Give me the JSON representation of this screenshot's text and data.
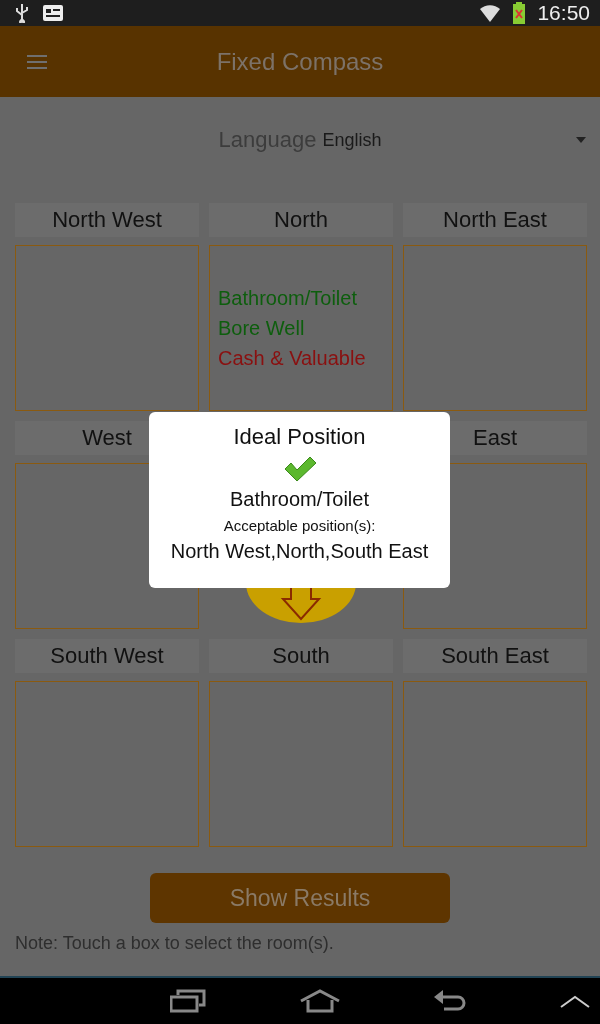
{
  "status_bar": {
    "time": "16:50"
  },
  "app_bar": {
    "title": "Fixed Compass"
  },
  "language": {
    "label": "Language",
    "value": "English"
  },
  "grid": [
    {
      "kind": "room",
      "label": "North West"
    },
    {
      "kind": "room",
      "label": "North",
      "items": [
        {
          "text": "Bathroom/Toilet",
          "color": "#0d5e0d"
        },
        {
          "text": "Bore Well",
          "color": "#0d5e0d"
        },
        {
          "text": "Cash & Valuable",
          "color": "#8a1010"
        }
      ]
    },
    {
      "kind": "room",
      "label": "North East"
    },
    {
      "kind": "room",
      "label": "West"
    },
    {
      "kind": "compass"
    },
    {
      "kind": "room",
      "label": "East"
    },
    {
      "kind": "room",
      "label": "South West"
    },
    {
      "kind": "room",
      "label": "South"
    },
    {
      "kind": "room",
      "label": "South East"
    }
  ],
  "button": "Show Results",
  "note": "Note: Touch a box to select the room(s).",
  "dialog": {
    "title": "Ideal Position",
    "room": "Bathroom/Toilet",
    "subtitle": "Acceptable position(s):",
    "positions": "North West,North,South East"
  }
}
